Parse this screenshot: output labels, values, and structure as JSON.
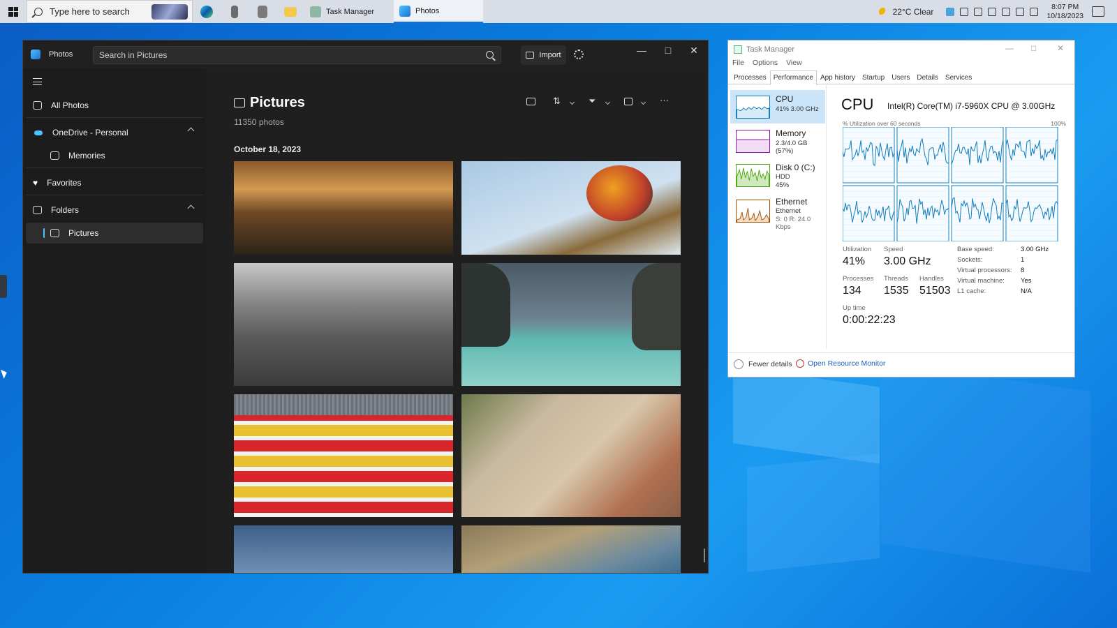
{
  "taskbar": {
    "search_placeholder": "Type here to search",
    "apps": [
      {
        "label": "Task Manager",
        "active": false
      },
      {
        "label": "Photos",
        "active": true
      }
    ],
    "weather": "22°C  Clear",
    "time": "8:07 PM",
    "date": "10/18/2023"
  },
  "photos": {
    "app_name": "Photos",
    "search_placeholder": "Search in Pictures",
    "import_label": "Import",
    "sidebar": {
      "all_photos": "All Photos",
      "onedrive": "OneDrive - Personal",
      "memories": "Memories",
      "favorites": "Favorites",
      "folders": "Folders",
      "pictures": "Pictures"
    },
    "heading": "Pictures",
    "count": "11350 photos",
    "date_group": "October 18, 2023",
    "thumbnails": [
      {
        "name": "mountain-sunset-forest"
      },
      {
        "name": "hot-air-balloon-sky"
      },
      {
        "name": "black-white-city-aerial"
      },
      {
        "name": "turquoise-sea-cliffs"
      },
      {
        "name": "red-yellow-striped-wall"
      },
      {
        "name": "old-town-street"
      },
      {
        "name": "blue-sky-birds"
      },
      {
        "name": "aerial-coastline"
      }
    ]
  },
  "task_manager": {
    "title": "Task Manager",
    "menu": [
      "File",
      "Options",
      "View"
    ],
    "tabs": [
      "Processes",
      "Performance",
      "App history",
      "Startup",
      "Users",
      "Details",
      "Services"
    ],
    "active_tab": "Performance",
    "resources": [
      {
        "name": "CPU",
        "lines": [
          "41% 3.00 GHz"
        ],
        "color": "#117dbb"
      },
      {
        "name": "Memory",
        "lines": [
          "2.3/4.0 GB (57%)"
        ],
        "color": "#8b12ae"
      },
      {
        "name": "Disk 0 (C:)",
        "lines": [
          "HDD",
          "45%"
        ],
        "color": "#4da60c"
      },
      {
        "name": "Ethernet",
        "lines": [
          "Ethernet",
          "S: 0 R: 24.0 Kbps"
        ],
        "color": "#a74f01"
      }
    ],
    "cpu": {
      "heading": "CPU",
      "model": "Intel(R) Core(TM) i7-5960X CPU @ 3.00GHz",
      "util_caption": "% Utilization over 60 seconds",
      "util_max": "100%",
      "utilization_label": "Utilization",
      "utilization": "41%",
      "speed_label": "Speed",
      "speed": "3.00 GHz",
      "processes_label": "Processes",
      "processes": "134",
      "threads_label": "Threads",
      "threads": "1535",
      "handles_label": "Handles",
      "handles": "51503",
      "uptime_label": "Up time",
      "uptime": "0:00:22:23",
      "details": [
        {
          "k": "Base speed:",
          "v": "3.00 GHz"
        },
        {
          "k": "Sockets:",
          "v": "1"
        },
        {
          "k": "Virtual processors:",
          "v": "8"
        },
        {
          "k": "Virtual machine:",
          "v": "Yes"
        },
        {
          "k": "L1 cache:",
          "v": "N/A"
        }
      ]
    },
    "fewer_details": "Fewer details",
    "open_resource_monitor": "Open Resource Monitor"
  }
}
